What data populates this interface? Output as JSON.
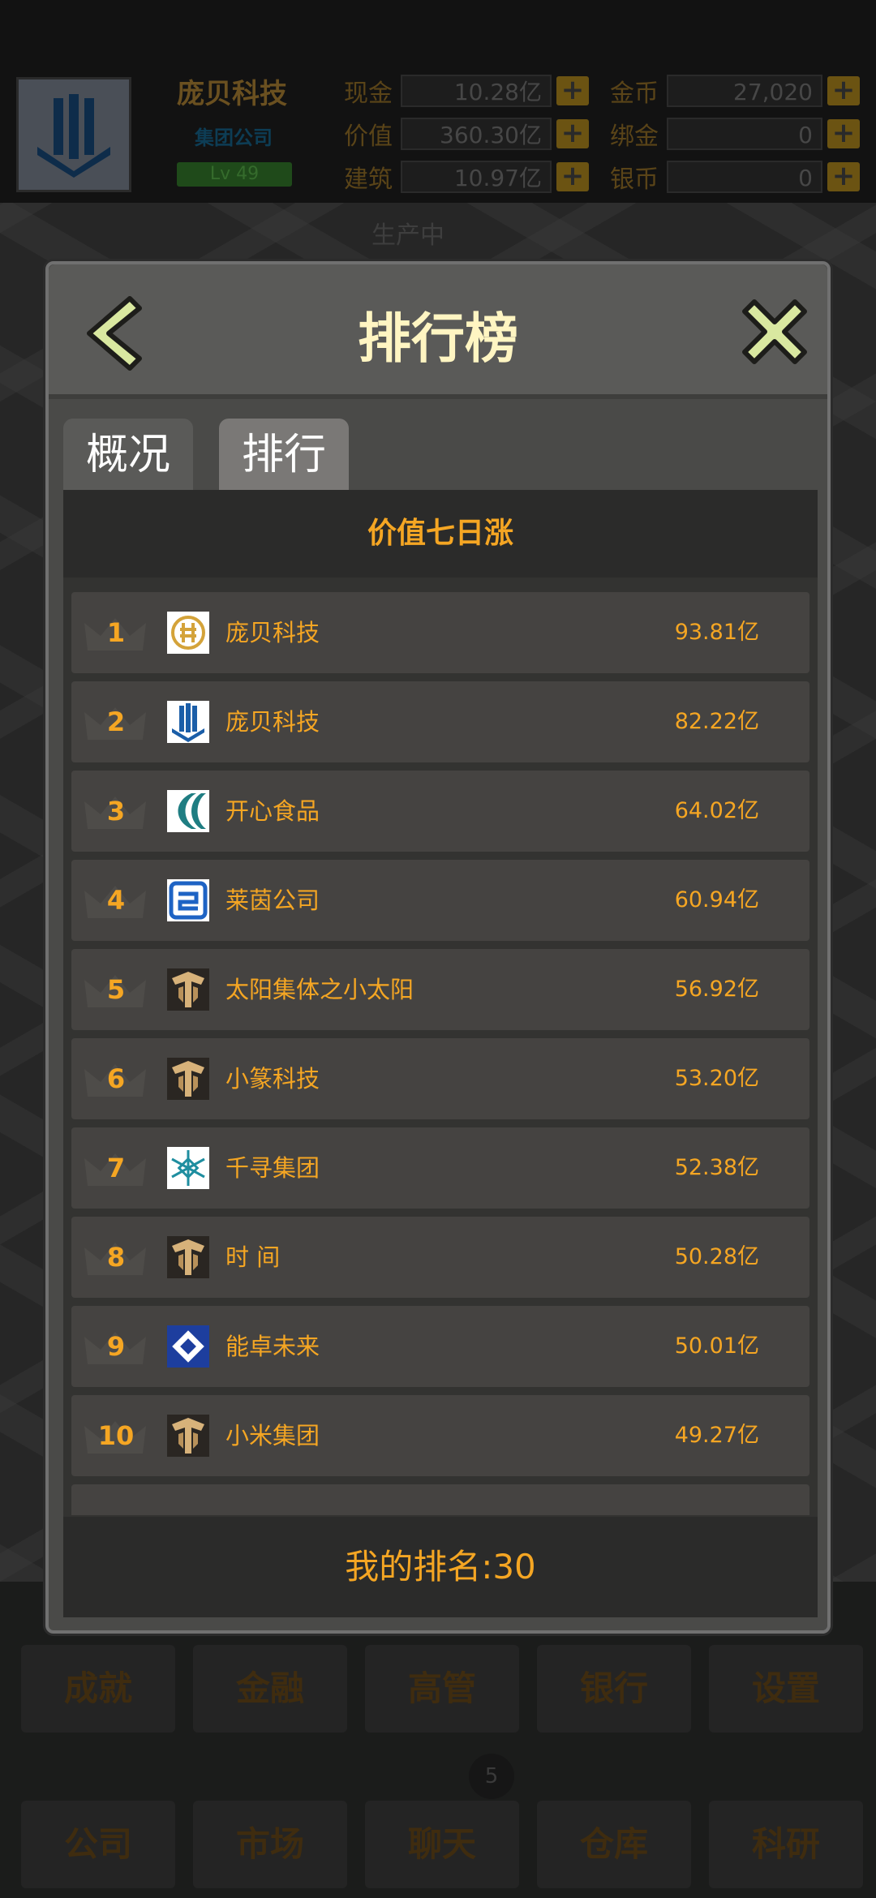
{
  "header": {
    "company_name": "庞贝科技",
    "company_type": "集团公司",
    "level": "Lv 49",
    "resources": [
      {
        "label": "现金",
        "value": "10.28亿"
      },
      {
        "label": "价值",
        "value": "360.30亿"
      },
      {
        "label": "建筑",
        "value": "10.97亿"
      },
      {
        "label": "金币",
        "value": "27,020"
      },
      {
        "label": "绑金",
        "value": "0"
      },
      {
        "label": "银币",
        "value": "0"
      }
    ]
  },
  "background": {
    "status_text": "生产中"
  },
  "modal": {
    "title": "排行榜",
    "tabs": [
      {
        "label": "概况",
        "active": false
      },
      {
        "label": "排行",
        "active": true
      }
    ],
    "list_title": "价值七日涨",
    "rows": [
      {
        "rank": "1",
        "name": "庞贝科技",
        "value": "93.81亿",
        "logo": "gold-coin-logo"
      },
      {
        "rank": "2",
        "name": "庞贝科技",
        "value": "82.22亿",
        "logo": "blue-building-logo"
      },
      {
        "rank": "3",
        "name": "开心食品",
        "value": "64.02亿",
        "logo": "teal-wave-logo"
      },
      {
        "rank": "4",
        "name": "莱茵公司",
        "value": "60.94亿",
        "logo": "blue-square-logo"
      },
      {
        "rank": "5",
        "name": "太阳集体之小太阳",
        "value": "56.92亿",
        "logo": "gold-shield-logo"
      },
      {
        "rank": "6",
        "name": "小篆科技",
        "value": "53.20亿",
        "logo": "gold-shield-logo"
      },
      {
        "rank": "7",
        "name": "千寻集团",
        "value": "52.38亿",
        "logo": "teal-snowflake-logo"
      },
      {
        "rank": "8",
        "name": "时 间",
        "value": "50.28亿",
        "logo": "gold-shield-logo"
      },
      {
        "rank": "9",
        "name": "能卓未来",
        "value": "50.01亿",
        "logo": "blue-diamond-logo"
      },
      {
        "rank": "10",
        "name": "小米集团",
        "value": "49.27亿",
        "logo": "gold-shield-logo"
      }
    ],
    "my_rank": "我的排名:30"
  },
  "bottom_nav": {
    "row1": [
      "成就",
      "金融",
      "高管",
      "银行",
      "设置"
    ],
    "row2": [
      "公司",
      "市场",
      "聊天",
      "仓库",
      "科研"
    ],
    "chat_badge": "5"
  },
  "colors": {
    "accent": "#f5a623",
    "title": "#fff5c2",
    "button": "#d9e8a0"
  }
}
